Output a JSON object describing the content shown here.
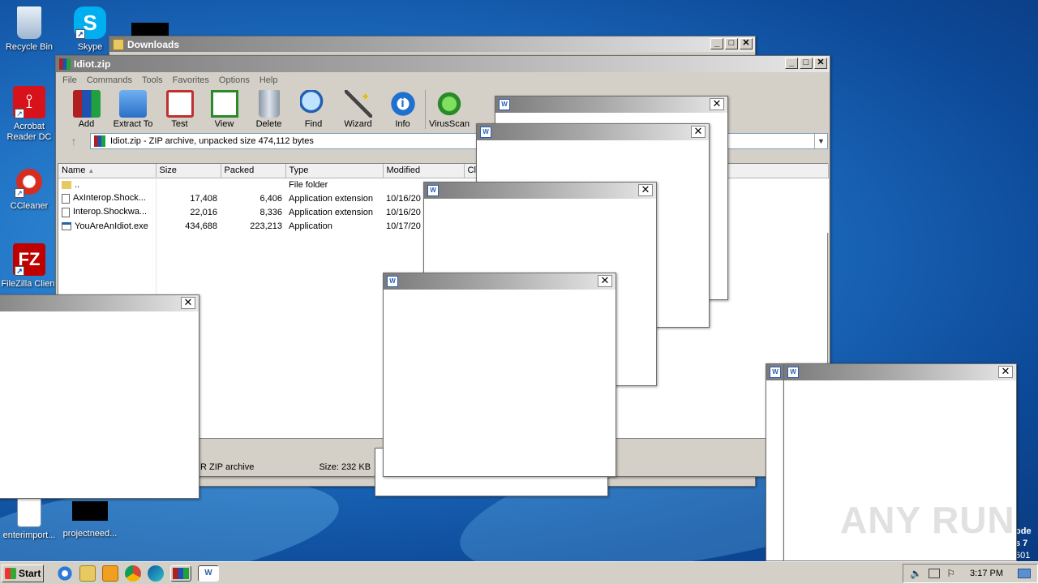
{
  "desktop_icons": [
    {
      "label": "Recycle Bin",
      "icon": "recycle-bin-icon"
    },
    {
      "label": "Skype",
      "icon": "skype-icon"
    },
    {
      "label": "Acrobat Reader DC",
      "icon": "acrobat-icon"
    },
    {
      "label": "CCleaner",
      "icon": "ccleaner-icon"
    },
    {
      "label": "FileZilla Client",
      "icon": "filezilla-icon"
    },
    {
      "label": "enterimport...",
      "icon": "document-icon"
    },
    {
      "label": "projectneed...",
      "icon": "black-file-icon"
    }
  ],
  "downloads_window": {
    "title": "Downloads"
  },
  "winrar": {
    "title": "Idiot.zip",
    "menu": [
      "File",
      "Commands",
      "Tools",
      "Favorites",
      "Options",
      "Help"
    ],
    "toolbar": [
      {
        "label": "Add",
        "icon": "add-archive-icon"
      },
      {
        "label": "Extract To",
        "icon": "extract-folder-icon"
      },
      {
        "label": "Test",
        "icon": "test-clipboard-icon"
      },
      {
        "label": "View",
        "icon": "view-book-icon"
      },
      {
        "label": "Delete",
        "icon": "trash-icon"
      },
      {
        "label": "Find",
        "icon": "magnifier-icon"
      },
      {
        "label": "Wizard",
        "icon": "wand-icon"
      },
      {
        "label": "Info",
        "icon": "info-icon"
      },
      {
        "label": "VirusScan",
        "icon": "virus-icon"
      }
    ],
    "address": "Idiot.zip - ZIP archive, unpacked size 474,112 bytes",
    "columns": [
      "Name",
      "Size",
      "Packed",
      "Type",
      "Modified",
      "Cl"
    ],
    "rows": [
      {
        "name": "..",
        "size": "",
        "packed": "",
        "type": "File folder",
        "modified": ""
      },
      {
        "name": "AxInterop.Shock...",
        "size": "17,408",
        "packed": "6,406",
        "type": "Application extension",
        "modified": "10/16/20"
      },
      {
        "name": "Interop.Shockwa...",
        "size": "22,016",
        "packed": "8,336",
        "type": "Application extension",
        "modified": "10/16/20"
      },
      {
        "name": "YouAreAnIdiot.exe",
        "size": "434,688",
        "packed": "223,213",
        "type": "Application",
        "modified": "10/17/20"
      }
    ],
    "status_left": "R ZIP archive",
    "status_size": "Size: 232 KB"
  },
  "popup_close_glyph": "✕",
  "watermark": "ANY RUN",
  "edge_text": [
    "ode",
    "s 7",
    "601"
  ],
  "taskbar": {
    "start": "Start",
    "quick": [
      "ie-icon",
      "explorer-icon",
      "media-player-icon",
      "chrome-icon",
      "edge-icon",
      "winrar-icon",
      "popup-app-icon"
    ],
    "time": "3:17 PM"
  }
}
